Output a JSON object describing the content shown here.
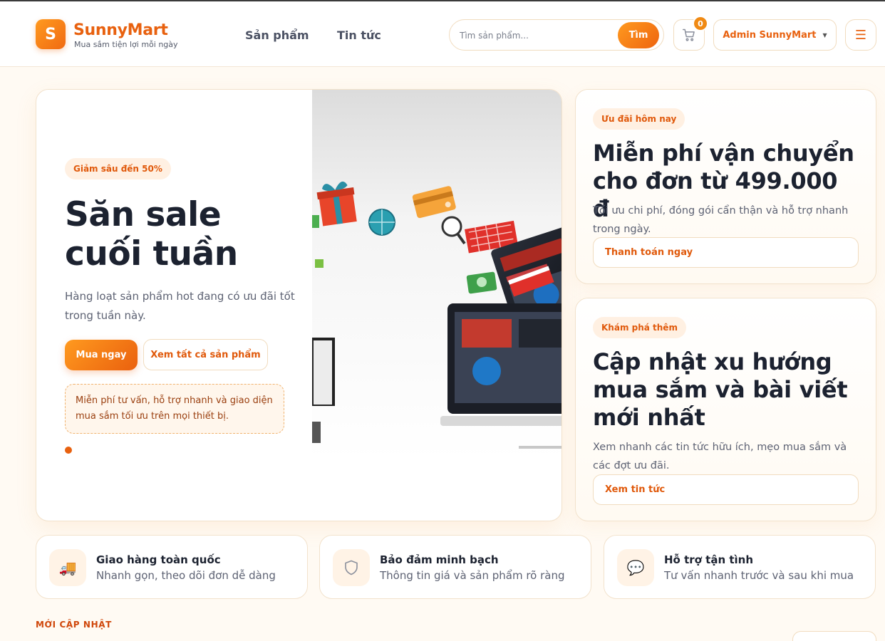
{
  "brand": {
    "logo_letter": "S",
    "name": "SunnyMart",
    "tagline": "Mua sắm tiện lợi mỗi ngày",
    "accent": "#e8610f"
  },
  "nav": [
    {
      "label": "Sản phẩm"
    },
    {
      "label": "Tin tức"
    }
  ],
  "search": {
    "placeholder": "Tìm sản phẩm...",
    "button_label": "Tìm"
  },
  "cart": {
    "count": "0",
    "icon": "cart-icon"
  },
  "user": {
    "label": "Admin SunnyMart",
    "caret": "▼"
  },
  "menu": {
    "icon": "hamburger-icon",
    "glyph": "☰"
  },
  "hero": {
    "badge": "Giảm sâu đến 50%",
    "title": "Săn sale cuối tuần",
    "description": "Hàng loạt sản phẩm hot đang có ưu đãi tốt trong tuần này.",
    "primary_button": "Mua ngay",
    "secondary_button": "Xem tất cả sản phẩm",
    "note": "Miễn phí tư vấn, hỗ trợ nhanh và giao diện mua sắm tối ưu trên mọi thiết bị."
  },
  "promo_cards": [
    {
      "badge": "Ưu đãi hôm nay",
      "title": "Miễn phí vận chuyển cho đơn từ 499.000 đ",
      "description": "Tối ưu chi phí, đóng gói cẩn thận và hỗ trợ nhanh trong ngày.",
      "button": "Thanh toán ngay"
    },
    {
      "badge": "Khám phá thêm",
      "title": "Cập nhật xu hướng mua sắm và bài viết mới nhất",
      "description": "Xem nhanh các tin tức hữu ích, mẹo mua sắm và các đợt ưu đãi.",
      "button": "Xem tin tức"
    }
  ],
  "features": [
    {
      "icon": "truck-icon",
      "glyph": "🚚",
      "title": "Giao hàng toàn quốc",
      "subtitle": "Nhanh gọn, theo dõi đơn dễ dàng"
    },
    {
      "icon": "shield-icon",
      "glyph": "🛡",
      "title": "Bảo đảm minh bạch",
      "subtitle": "Thông tin giá và sản phẩm rõ ràng"
    },
    {
      "icon": "chat-bubble-icon",
      "glyph": "💬",
      "title": "Hỗ trợ tận tình",
      "subtitle": "Tư vấn nhanh trước và sau khi mua"
    }
  ],
  "section": {
    "label": "MỚI CẬP NHẬT"
  }
}
